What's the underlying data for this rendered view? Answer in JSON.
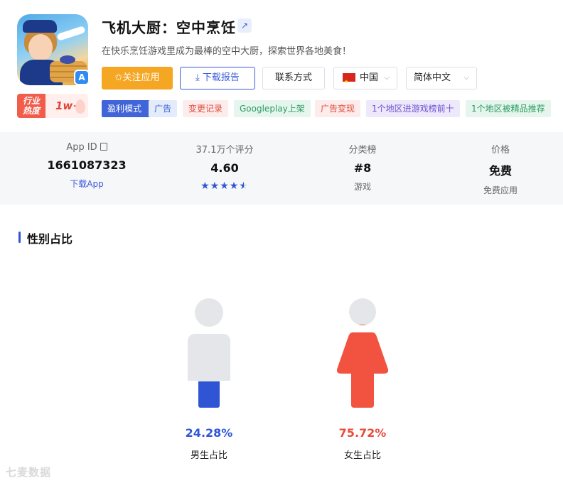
{
  "app": {
    "title": "飞机大厨：空中烹饪",
    "subtitle": "在快乐烹饪游戏里成为最棒的空中大厨，探索世界各地美食！",
    "heat_label_line1": "行业",
    "heat_label_line2": "热度",
    "heat_value": "1w+",
    "store_badge": "A",
    "ext_link_icon": "↗"
  },
  "buttons": {
    "follow": "✩关注应用",
    "report": "⤓ 下载报告",
    "contact": "联系方式",
    "country": "中国",
    "language": "简体中文",
    "caret": "⌵"
  },
  "tags": {
    "model": "盈利模式",
    "ad": "广告",
    "changes": "变更记录",
    "googleplay": "Googleplay上架",
    "ad_monetization": "广告变现",
    "top10": "1个地区进游戏榜前十",
    "featured": "1个地区被精品推荐"
  },
  "stats": [
    {
      "label": "App ID",
      "value": "1661087323",
      "sub": "下载App"
    },
    {
      "label": "37.1万个评分",
      "value": "4.60",
      "sub": ""
    },
    {
      "label": "分类榜",
      "value": "#8",
      "sub": "游戏"
    },
    {
      "label": "价格",
      "value": "免费",
      "sub": "免费应用"
    }
  ],
  "rating": {
    "value": 4.6,
    "stars_full": "★★★★"
  },
  "gender": {
    "title": "性别占比",
    "male": {
      "percent_text": "24.28%",
      "label": "男生占比",
      "fraction": 0.2428
    },
    "female": {
      "percent_text": "75.72%",
      "label": "女生占比",
      "fraction": 0.7572
    }
  },
  "colors": {
    "accent": "#2f55d4",
    "follow": "#f5a623",
    "female": "#f25240",
    "empty": "#e5e6ea"
  },
  "watermark": "七麦数据"
}
